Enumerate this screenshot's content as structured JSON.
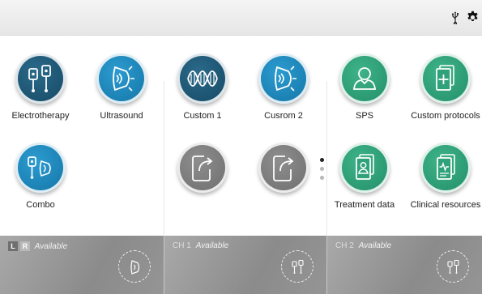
{
  "topbar": {
    "usb_icon": "usb-icon",
    "settings_icon": "gear-icon"
  },
  "tiles": {
    "electrotherapy": {
      "label": "Electrotherapy",
      "icon": "electrodes-icon",
      "color": "#1c5877"
    },
    "ultrasound": {
      "label": "Ultrasound",
      "icon": "ultrasound-head-icon",
      "color": "#1f8cc1"
    },
    "combo": {
      "label": "Combo",
      "icon": "combo-icon",
      "color": "#1f8cc1"
    },
    "custom1": {
      "label": "Custom 1",
      "icon": "waveform-icon",
      "color": "#1c5877"
    },
    "custom2": {
      "label": "Cusrom 2",
      "icon": "ultrasound-head-icon",
      "color": "#1f8cc1"
    },
    "empty1": {
      "label": "",
      "icon": "export-icon",
      "color": "#7d7d7d"
    },
    "empty2": {
      "label": "",
      "icon": "export-icon",
      "color": "#7d7d7d"
    },
    "sps": {
      "label": "SPS",
      "icon": "person-icon",
      "color": "#2fa27b"
    },
    "custom_protocols": {
      "label": "Custom protocols",
      "icon": "add-document-icon",
      "color": "#2fa27b"
    },
    "treatment_data": {
      "label": "Treatment data",
      "icon": "patient-file-icon",
      "color": "#2fa27b"
    },
    "clinical_resources": {
      "label": "Clinical resources",
      "icon": "clinical-document-icon",
      "color": "#2fa27b"
    }
  },
  "pager": {
    "pages": 3,
    "active": 1
  },
  "channels": {
    "us": {
      "left_badge": "L",
      "right_badge": "R",
      "status": "Available",
      "icon": "ultrasound-head-icon"
    },
    "ch1": {
      "name": "CH 1",
      "status": "Available",
      "icon": "electrodes-icon"
    },
    "ch2": {
      "name": "CH 2",
      "status": "Available",
      "icon": "electrodes-icon"
    }
  }
}
